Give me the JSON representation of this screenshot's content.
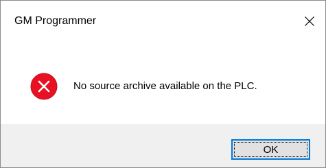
{
  "window": {
    "title": "GM Programmer",
    "close_icon": "close-icon"
  },
  "message": {
    "icon": "error-icon",
    "icon_color": "#e81123",
    "text": "No source archive available on the PLC."
  },
  "buttons": {
    "ok_label": "OK"
  },
  "colors": {
    "accent": "#0078d7",
    "footer_bg": "#f0f0f0"
  }
}
